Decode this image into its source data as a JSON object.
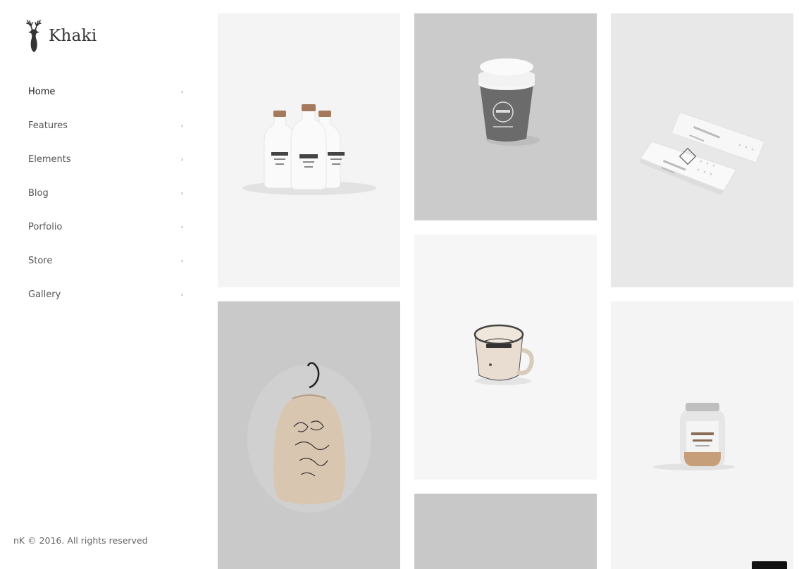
{
  "brand": {
    "name": "Khaki",
    "logo_icon": "deer-icon"
  },
  "nav": {
    "items": [
      {
        "label": "Home",
        "active": true
      },
      {
        "label": "Features",
        "active": false
      },
      {
        "label": "Elements",
        "active": false
      },
      {
        "label": "Blog",
        "active": false
      },
      {
        "label": "Porfolio",
        "active": false
      },
      {
        "label": "Store",
        "active": false
      },
      {
        "label": "Gallery",
        "active": false
      }
    ],
    "chevron_icon": "chevron-right-icon"
  },
  "footer": {
    "copyright": "nK © 2016. All rights reserved"
  },
  "gallery": {
    "items": [
      {
        "name": "milk-bottles-mockup"
      },
      {
        "name": "fabric-bag-mockup"
      },
      {
        "name": "coffee-cup-mockup"
      },
      {
        "name": "enamel-mug-mockup"
      },
      {
        "name": "grey-placeholder"
      },
      {
        "name": "business-card-mockup"
      },
      {
        "name": "mason-jar-mockup"
      }
    ]
  },
  "colors": {
    "text": "#333333",
    "muted": "#666666",
    "tile_light": "#f4f4f4",
    "tile_grey": "#c9c9c9"
  },
  "back_to_top_icon": "arrow-up-icon"
}
